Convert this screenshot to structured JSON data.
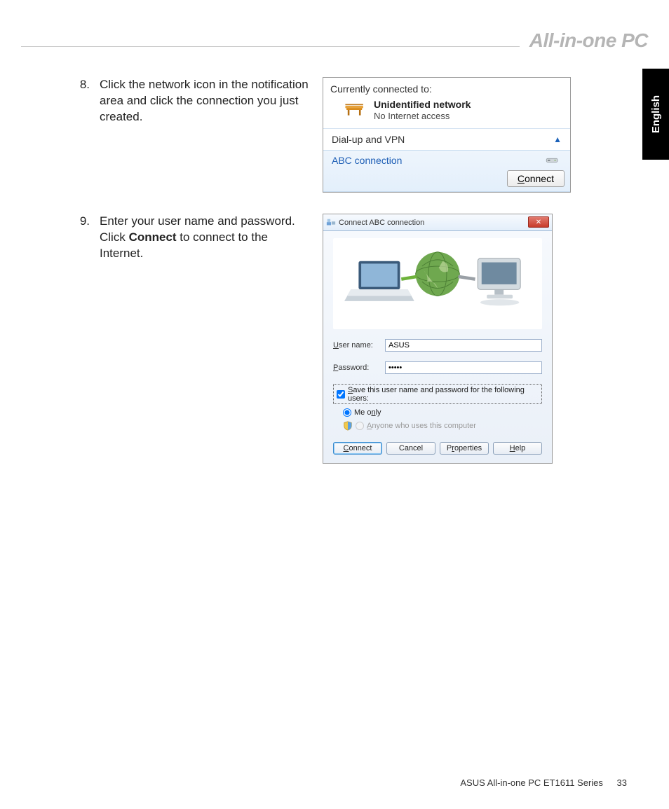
{
  "header": {
    "title": "All-in-one PC"
  },
  "lang": "English",
  "steps": {
    "s8": {
      "num": "8.",
      "text": "Click the network icon in the notification area and click the connection you just created."
    },
    "s9": {
      "num": "9.",
      "pre": "Enter your user name and password. Click ",
      "bold": "Connect",
      "post": " to connect to the Internet."
    }
  },
  "flyout": {
    "connected_label": "Currently connected to:",
    "network_name": "Unidentified network",
    "network_sub": "No Internet access",
    "section_label": "Dial-up and VPN",
    "connection_name": "ABC connection",
    "connect_btn_prefix": "C",
    "connect_btn_rest": "onnect"
  },
  "dialog": {
    "title": "Connect ABC connection",
    "username_label_u": "U",
    "username_label_rest": "ser name:",
    "username_value": "ASUS",
    "password_label_u": "P",
    "password_label_rest": "assword:",
    "password_value": "•••••",
    "save_u": "S",
    "save_rest": "ave this user name and password for the following users:",
    "me_only": "Me o",
    "me_only_u": "n",
    "me_only_rest": "ly",
    "anyone_u": "A",
    "anyone_rest": "nyone who uses this computer",
    "btn_connect_u": "C",
    "btn_connect_rest": "onnect",
    "btn_cancel": "Cancel",
    "btn_props_pre": "P",
    "btn_props_u": "r",
    "btn_props_rest": "operties",
    "btn_help_u": "H",
    "btn_help_rest": "elp"
  },
  "footer": {
    "text": "ASUS All-in-one PC  ET1611 Series",
    "page": "33"
  }
}
